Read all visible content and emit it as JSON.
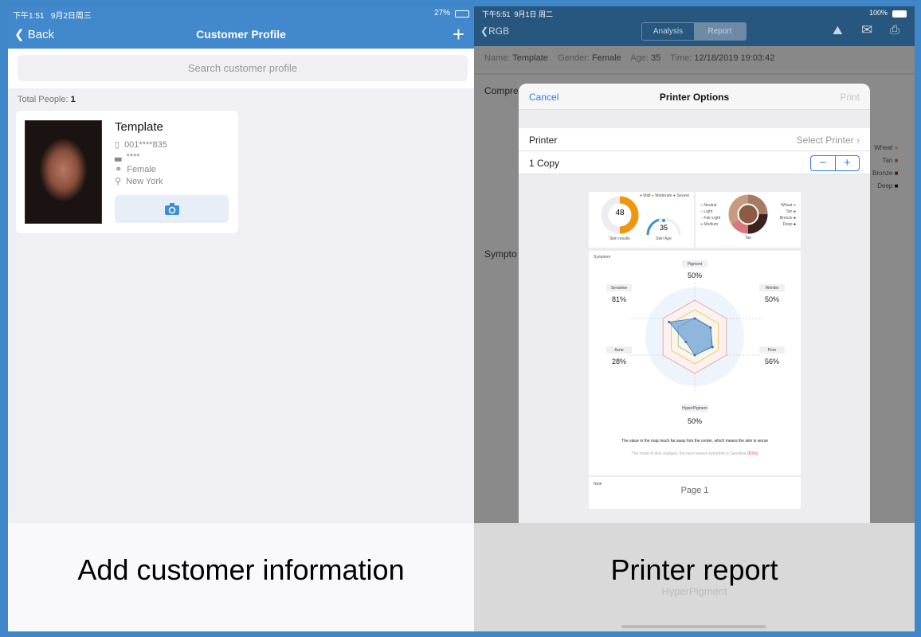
{
  "left": {
    "status": {
      "time": "下午1:51",
      "date": "9月2日周三",
      "battery": "27%"
    },
    "nav": {
      "back": "Back",
      "title": "Customer Profile",
      "add_icon": "plus-icon"
    },
    "search_placeholder": "Search customer profile",
    "total_label": "Total People:",
    "total_value": "1",
    "customer": {
      "name": "Template",
      "phone": "001****835",
      "birthday": "****",
      "gender": "Female",
      "city": "New York"
    },
    "caption": "Add customer information"
  },
  "right": {
    "status": {
      "time": "下午5:51",
      "date": "9月1日 周二",
      "battery": "100%"
    },
    "nav": {
      "back": "RGB",
      "tabs": [
        "Analysis",
        "Report"
      ],
      "active_tab": "Report"
    },
    "info": {
      "name_label": "Name:",
      "name": "Template",
      "gender_label": "Gender:",
      "gender": "Female",
      "age_label": "Age:",
      "age": "35",
      "time_label": "Time:",
      "time": "12/18/2019 19:03:42"
    },
    "background": {
      "section1": "Compre",
      "section2": "Sympto",
      "legend": [
        "Wheat",
        "Tan",
        "Bronze",
        "Deep"
      ],
      "bottom_label": "HyperPigment"
    },
    "modal": {
      "cancel": "Cancel",
      "title": "Printer Options",
      "print": "Print",
      "printer_label": "Printer",
      "printer_value": "Select Printer",
      "copies": "1 Copy"
    },
    "preview": {
      "severity_legend": [
        "Mild",
        "Moderate",
        "Severe"
      ],
      "skin_results": {
        "value": "48",
        "label": "Skin results"
      },
      "skin_age": {
        "value": "35",
        "label": "Skin Age"
      },
      "tone_left": [
        "Neutral",
        "Light",
        "Fair Light",
        "Medium"
      ],
      "tone_right": [
        "Wheat",
        "Tan",
        "Bronze",
        "Deep"
      ],
      "tone_label": "Tan",
      "symptom_title": "Symptom",
      "radar": [
        {
          "name": "Pigment",
          "value": 50
        },
        {
          "name": "Wrinkle",
          "value": 50
        },
        {
          "name": "Pore",
          "value": 56
        },
        {
          "name": "HyperPigment",
          "value": 50
        },
        {
          "name": "Acne",
          "value": 28
        },
        {
          "name": "Sensitive",
          "value": 81
        }
      ],
      "note1": "The value in the map much far away fom the center, which means the skin is worse",
      "note2": "The result of skin analysis, the most severe symptom is Sensitive",
      "note2_highlight": "(81%)",
      "note_label": "Note",
      "page": "Page 1"
    },
    "caption": "Printer report"
  },
  "colors": {
    "blue": "#4188cc",
    "dark_nav": "#27567f",
    "ios_blue": "#2f7ee6",
    "orange": "#f0960e"
  }
}
